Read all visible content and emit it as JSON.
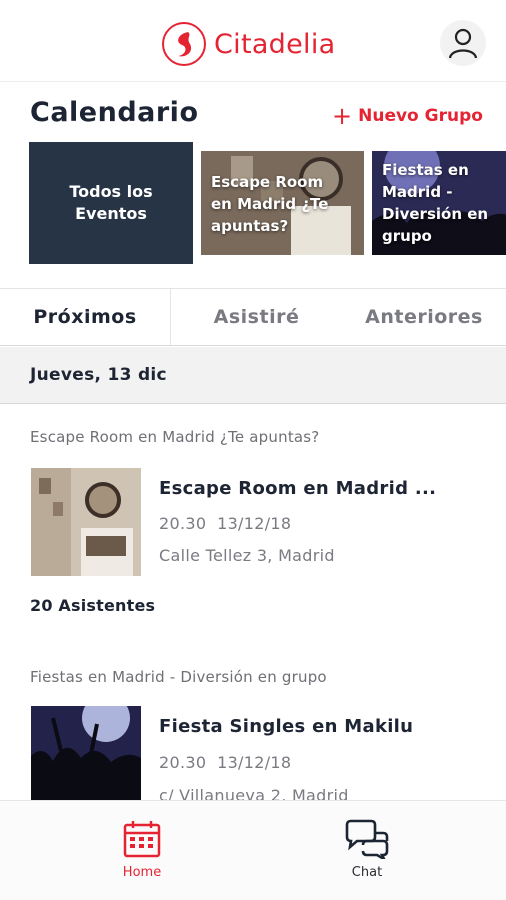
{
  "header": {
    "app_name": "Citadelia",
    "logo_icon": "citadelia-logo-icon",
    "profile_icon": "user-icon",
    "brand_color": "#e52433"
  },
  "calendar": {
    "title": "Calendario",
    "new_group_label": "Nuevo Grupo",
    "new_group_icon": "plus-icon"
  },
  "group_cards": [
    {
      "label": "Todos los Eventos",
      "line1": "Todos los",
      "line2": "Eventos"
    },
    {
      "label": "Escape Room en Madrid ¿Te apuntas?",
      "line1": "Escape Room",
      "line2": "en Madrid ¿Te",
      "line3": "apuntas?"
    },
    {
      "label": "Fiestas en Madrid - Diversión en grupo",
      "line1": "Fiestas en",
      "line2": "Madrid -",
      "line3": "Diversión en",
      "line4": "grupo"
    }
  ],
  "tabs": [
    {
      "label": "Próximos",
      "active": true
    },
    {
      "label": "Asistiré",
      "active": false
    },
    {
      "label": "Anteriores",
      "active": false
    }
  ],
  "date_header": "Jueves, 13 dic",
  "events": [
    {
      "group": "Escape Room en Madrid ¿Te apuntas?",
      "title": "Escape Room en Madrid ...",
      "time": "20.30",
      "date": "13/12/18",
      "address": "Calle Tellez 3, Madrid",
      "attendees": "20 Asistentes"
    },
    {
      "group": "Fiestas en Madrid - Diversión en grupo",
      "title": "Fiesta Singles en Makilu",
      "time": "20.30",
      "date": "13/12/18",
      "address": "c/ Villanueva 2, Madrid"
    }
  ],
  "bottom_nav": [
    {
      "label": "Home",
      "icon": "calendar-icon",
      "active": true
    },
    {
      "label": "Chat",
      "icon": "chat-bubbles-icon",
      "active": false
    }
  ]
}
